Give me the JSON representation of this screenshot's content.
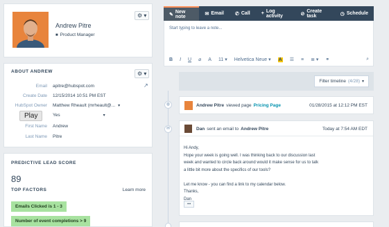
{
  "contact": {
    "name": "Andrew Pitre",
    "title": "Product Manager"
  },
  "about": {
    "heading": "ABOUT ANDREW",
    "fields": [
      {
        "label": "Email",
        "value": "apitre@hubspot.com"
      },
      {
        "label": "Create Date",
        "value": "12/15/2014 10:51 PM EST"
      },
      {
        "label": "HubSpot Owner",
        "value": "Matthew Rheault (mrheault@..."
      },
      {
        "label": "",
        "value": "Yes"
      },
      {
        "label": "First Name",
        "value": "Andrew"
      },
      {
        "label": "Last Name",
        "value": "Pitre"
      }
    ],
    "play_tooltip": "Play"
  },
  "score": {
    "heading": "PREDICTIVE LEAD SCORE",
    "value": "89",
    "factors_heading": "TOP FACTORS",
    "learn_more": "Learn more",
    "factors": [
      {
        "text": "Emails Clicked is 1 - 3"
      },
      {
        "text": "Number of event completions > 9"
      }
    ]
  },
  "toolbar": {
    "tabs": [
      {
        "icon": "✎",
        "label": "New note",
        "active": true
      },
      {
        "icon": "✉",
        "label": "Email",
        "active": false
      },
      {
        "icon": "✆",
        "label": "Call",
        "active": false
      },
      {
        "icon": "+",
        "label": "Log activity",
        "active": false
      },
      {
        "icon": "⊘",
        "label": "Create task",
        "active": false
      },
      {
        "icon": "◷",
        "label": "Schedule",
        "active": false
      }
    ]
  },
  "editor": {
    "placeholder": "Start typing to leave a note...",
    "font_size": "11",
    "font_family": "Helvetica Neue"
  },
  "filter": {
    "label": "Filter timeline",
    "count": "(4/28)"
  },
  "timeline": {
    "view_event": {
      "actor": "Andrew Pitre",
      "verb": "viewed page",
      "page": "Pricing Page",
      "time": "01/28/2015 at 12:12 PM EST"
    },
    "email_event": {
      "sender": "Dan",
      "verb": "sent an email to",
      "recipient": "Andrew Pitre",
      "time": "Today at 7:54 AM EDT",
      "body_lines": [
        "Hi Andy,",
        "Hope your week is going well. I was thinking back to our discussion last",
        "week and wanted to circle back around would it make sense for us to talk",
        "a little bit more about the specifics of our tools?",
        "",
        "Let me know - you can find a link to my calendar below.",
        "Thanks,",
        "Dan"
      ],
      "more": "•••"
    }
  },
  "colors": {
    "accent": "#ff8f59",
    "toolbar_bg": "#33475b",
    "link": "#0091ae",
    "factor_bg": "#a8e2a0"
  }
}
